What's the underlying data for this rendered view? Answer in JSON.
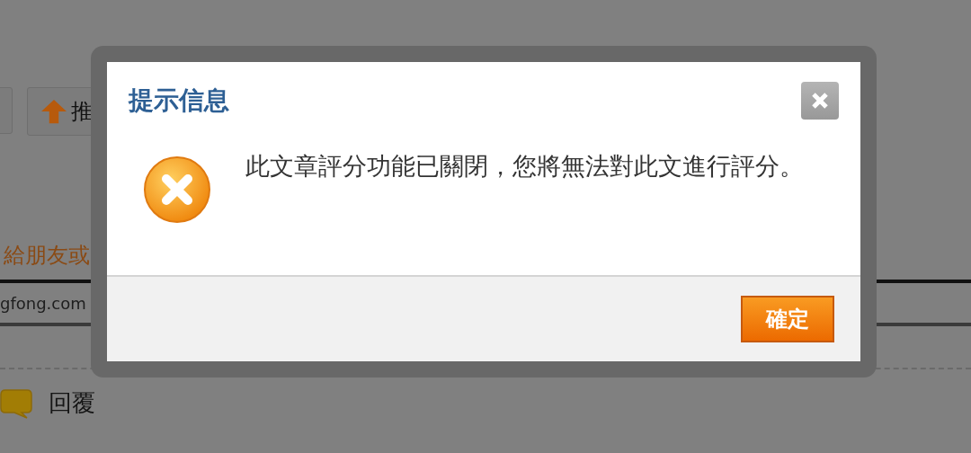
{
  "page": {
    "share_button": {
      "label": "推"
    },
    "share_hint": "給朋友或",
    "link_field": {
      "value": "gfong.com"
    },
    "reply_link": "回覆"
  },
  "dialog": {
    "title": "提示信息",
    "message": "此文章評分功能已關閉，您將無法對此文進行評分。",
    "confirm_button": "確定"
  }
}
